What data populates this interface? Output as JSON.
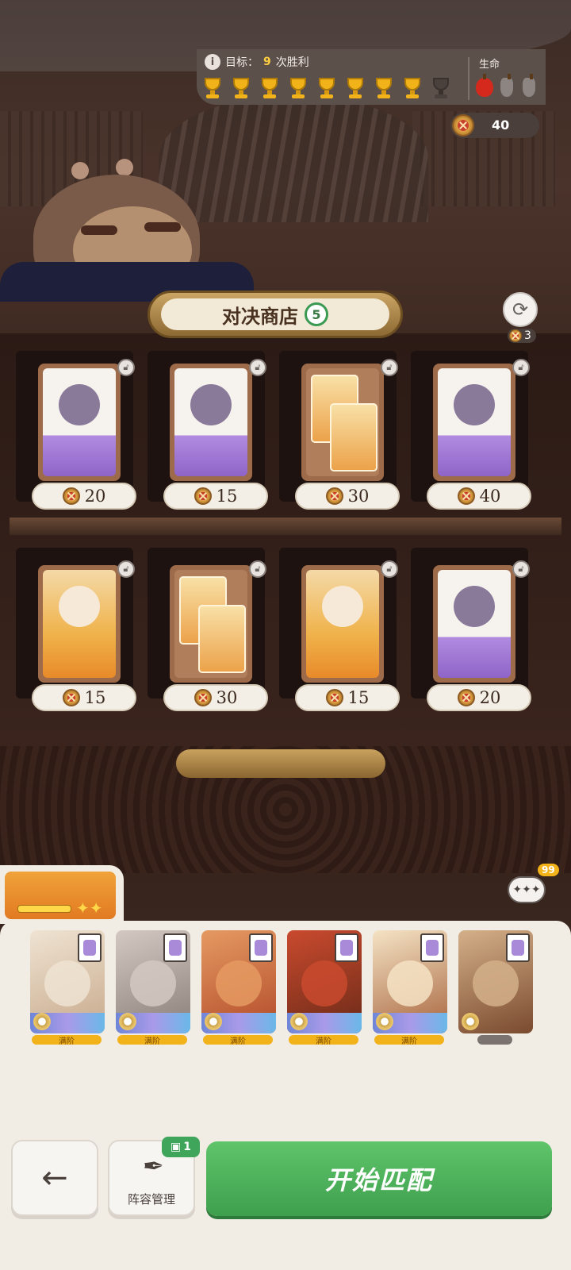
{
  "header": {
    "goal_label": "目标：",
    "goal_count": "9",
    "goal_suffix": "次胜利",
    "trophies_total": 9,
    "trophies_won": 8,
    "life_label": "生命",
    "lives_total": 3,
    "lives_remaining": 1,
    "coins": "40"
  },
  "shop": {
    "title": "对决商店",
    "level": "5",
    "refresh_cost": "3",
    "items": [
      {
        "price": "20",
        "art": "white",
        "icon": "skull-lasso-icon"
      },
      {
        "price": "15",
        "art": "white",
        "icon": "rhino-warrior-icon"
      },
      {
        "price": "30",
        "art": "brown",
        "icon": "twin-masked-cards-icon"
      },
      {
        "price": "40",
        "art": "white",
        "icon": "purple-knight-icon"
      },
      {
        "price": "15",
        "art": "orange",
        "icon": "moon-horn-child-icon"
      },
      {
        "price": "30",
        "art": "brown",
        "icon": "twin-flower-girl-cards-icon"
      },
      {
        "price": "15",
        "art": "orange",
        "icon": "golden-hair-girl-icon"
      },
      {
        "price": "20",
        "art": "white",
        "icon": "fire-lantern-icon"
      }
    ]
  },
  "chat": {
    "badge": "99",
    "label": "✦✦✦"
  },
  "team": [
    {
      "name": "badger-hero",
      "level": "满阶",
      "colors": [
        "#efe3d2",
        "#c7a98b"
      ]
    },
    {
      "name": "rhino-hero",
      "level": "满阶",
      "colors": [
        "#d3c8c2",
        "#8a7e78"
      ]
    },
    {
      "name": "red-beast-hero",
      "level": "满阶",
      "colors": [
        "#e59a62",
        "#b24a2a"
      ]
    },
    {
      "name": "owl-hero",
      "level": "满阶",
      "colors": [
        "#c94a2e",
        "#6a2a18"
      ]
    },
    {
      "name": "desert-woman-hero",
      "level": "满阶",
      "colors": [
        "#f4e3c4",
        "#a8643e"
      ]
    },
    {
      "name": "sleepy-kid-hero",
      "level": "",
      "colors": [
        "#d4b08a",
        "#7a4a2e"
      ]
    }
  ],
  "buttons": {
    "back_label": "←",
    "team_label": "阵容管理",
    "team_badge": "1",
    "start_label": "开始匹配"
  }
}
